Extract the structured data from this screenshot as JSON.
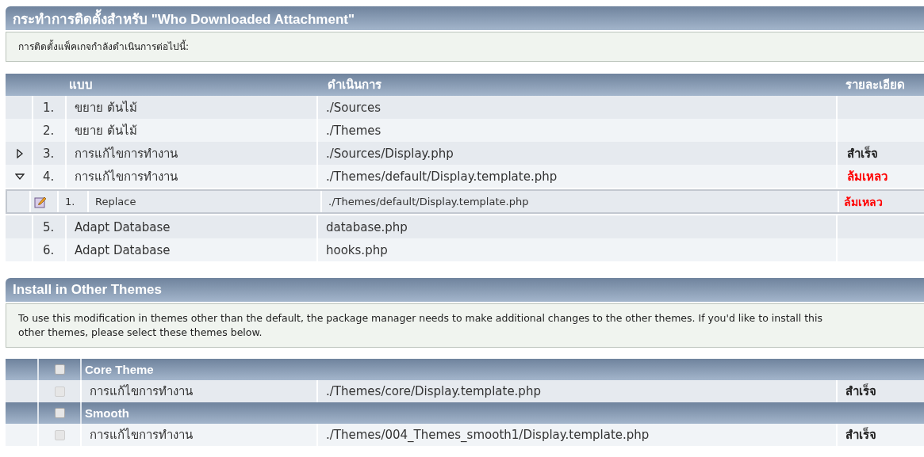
{
  "install_section": {
    "title": "กระทำการติดตั้งสำหรับ \"Who Downloaded Attachment\"",
    "info": "การติดตั้งแพ็คเกจกำลังดำเนินการต่อไปนี้:"
  },
  "actions_table": {
    "columns": [
      "แบบ",
      "ดำเนินการ",
      "รายละเอียด"
    ],
    "rows": [
      {
        "number": "1.",
        "type": "ขยาย ต้นไม้",
        "action": "./Sources"
      },
      {
        "number": "2.",
        "type": "ขยาย ต้นไม้",
        "action": "./Themes"
      },
      {
        "number": "3.",
        "type": "การแก้ไขการทำงาน",
        "action": "./Sources/Display.php",
        "expanded": false,
        "result": {
          "text": "สำเร็จ",
          "kind": "success"
        },
        "children": []
      },
      {
        "number": "4.",
        "type": "การแก้ไขการทำงาน",
        "action": "./Themes/default/Display.template.php",
        "expanded": true,
        "result": {
          "text": "ล้มเหลว",
          "kind": "failure"
        },
        "children": [
          {
            "number": "1.",
            "type": "Replace",
            "action": "./Themes/default/Display.template.php",
            "result": {
              "text": "ล้มเหลว",
              "kind": "failure"
            }
          }
        ]
      },
      {
        "number": "5.",
        "type": "Adapt Database",
        "action": "database.php"
      },
      {
        "number": "6.",
        "type": "Adapt Database",
        "action": "hooks.php"
      }
    ]
  },
  "themes_section": {
    "title": "Install in Other Themes",
    "info_lines": [
      "To use this modification in themes other than the default, the package manager needs to make additional changes to the other themes. If you'd like to install this",
      "other themes, please select these themes below."
    ]
  },
  "themes_table": {
    "groups": [
      {
        "name": "Core Theme",
        "checked": false,
        "rows": [
          {
            "type": "การแก้ไขการทำงาน",
            "action": "./Themes/core/Display.template.php",
            "checked": false,
            "result": {
              "text": "สำเร็จ",
              "kind": "success"
            }
          }
        ]
      },
      {
        "name": "Smooth",
        "checked": false,
        "rows": [
          {
            "type": "การแก้ไขการทำงาน",
            "action": "./Themes/004_Themes_smooth1/Display.template.php",
            "checked": false,
            "result": {
              "text": "สำเร็จ",
              "kind": "success"
            }
          }
        ]
      }
    ]
  }
}
